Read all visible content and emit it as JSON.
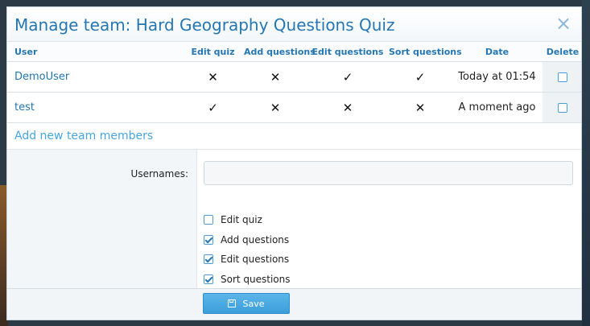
{
  "dialog": {
    "title": "Manage team: Hard Geography Questions Quiz",
    "close_icon": "×"
  },
  "table": {
    "headers": [
      "User",
      "Edit quiz",
      "Add questions",
      "Edit questions",
      "Sort questions",
      "Date",
      "Delete"
    ],
    "rows": [
      {
        "user": "DemoUser",
        "edit_quiz": "✕",
        "add_questions": "✕",
        "edit_questions": "✓",
        "sort_questions": "✓",
        "date": "Today at 01:54",
        "delete_checked": false
      },
      {
        "user": "test",
        "edit_quiz": "✓",
        "add_questions": "✕",
        "edit_questions": "✕",
        "sort_questions": "✕",
        "date": "A moment ago",
        "delete_checked": false
      }
    ]
  },
  "add_section": {
    "title": "Add new team members",
    "usernames_label": "Usernames:",
    "usernames_value": "",
    "permissions": [
      {
        "label": "Edit quiz",
        "checked": false
      },
      {
        "label": "Add questions",
        "checked": true
      },
      {
        "label": "Edit questions",
        "checked": true
      },
      {
        "label": "Sort questions",
        "checked": true
      }
    ]
  },
  "footer": {
    "save_label": "Save",
    "save_icon": "floppy-disk-icon"
  },
  "colors": {
    "accent": "#2577b1",
    "link": "#47a7dc",
    "button": "#3b9ed9"
  }
}
